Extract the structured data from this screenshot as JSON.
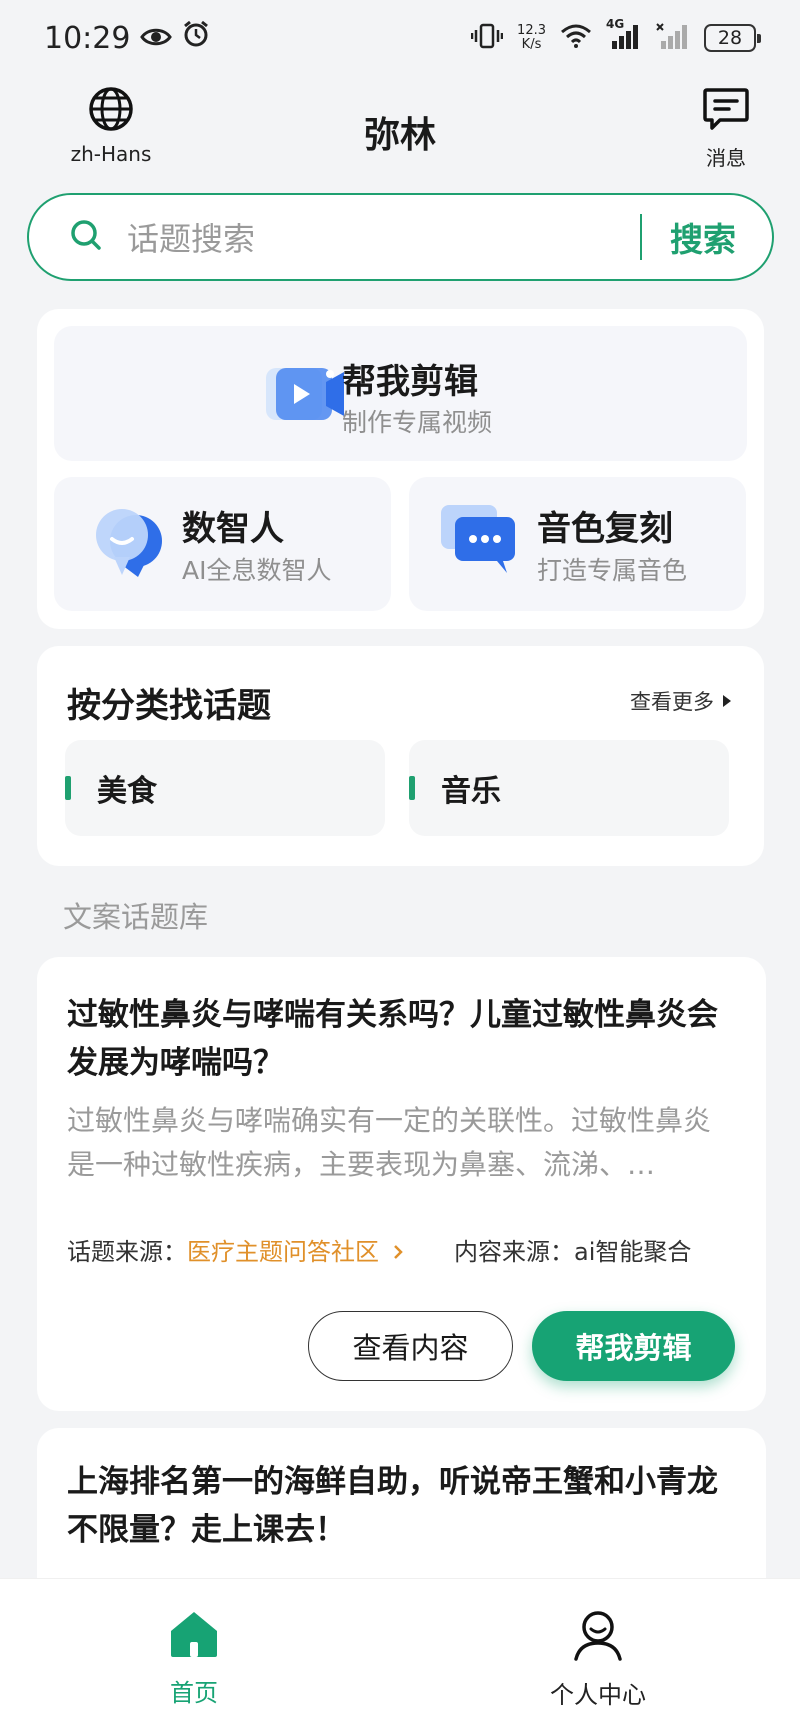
{
  "status_bar": {
    "time": "10:29",
    "net_speed_value": "12.3",
    "net_speed_unit": "K/s",
    "network": "4G",
    "battery": "28"
  },
  "header": {
    "lang_label": "zh-Hans",
    "title": "弥林",
    "messages_label": "消息"
  },
  "search": {
    "placeholder": "话题搜索",
    "button_label": "搜索"
  },
  "tools": {
    "main": {
      "title": "帮我剪辑",
      "subtitle": "制作专属视频"
    },
    "digital_human": {
      "title": "数智人",
      "subtitle": "AI全息数智人"
    },
    "voice_clone": {
      "title": "音色复刻",
      "subtitle": "打造专属音色"
    }
  },
  "categories": {
    "title": "按分类找话题",
    "more_label": "查看更多",
    "items": [
      {
        "label": "美食"
      },
      {
        "label": "音乐"
      }
    ]
  },
  "library": {
    "section_label": "文案话题库",
    "topics": [
      {
        "title": "过敏性鼻炎与哮喘有关系吗？儿童过敏性鼻炎会发展为哮喘吗？",
        "description": "过敏性鼻炎与哮喘确实有一定的关联性。过敏性鼻炎是一种过敏性疾病，主要表现为鼻塞、流涕、…",
        "topic_source_label": "话题来源：",
        "topic_source_value": "医疗主题问答社区",
        "content_source_label": "内容来源：",
        "content_source_value": "ai智能聚合",
        "view_label": "查看内容",
        "edit_label": "帮我剪辑"
      },
      {
        "title": "上海排名第一的海鲜自助，听说帝王蟹和小青龙不限量？走上课去！"
      }
    ]
  },
  "tabbar": {
    "home_label": "首页",
    "profile_label": "个人中心"
  },
  "colors": {
    "accent": "#17a374",
    "link_orange": "#e0902a"
  }
}
